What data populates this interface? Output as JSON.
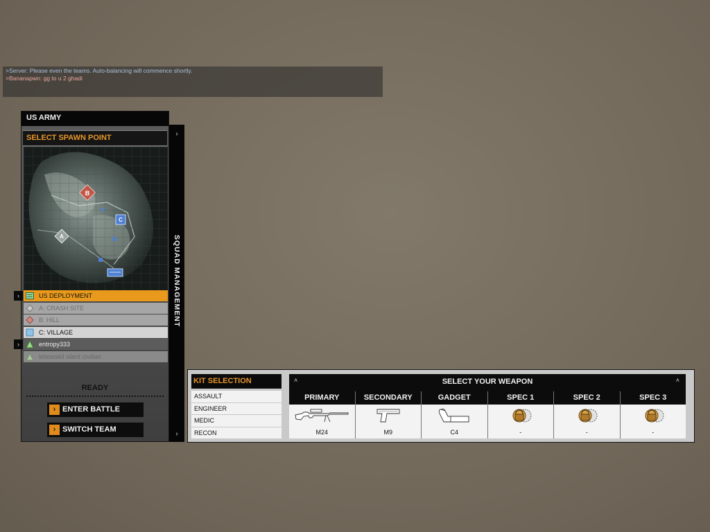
{
  "chat": {
    "lines": [
      ">Server: Please even the teams. Auto-balancing will commence shortly.",
      ">Bananapwn: gg to u 2 ghadi"
    ]
  },
  "team": {
    "name": "US ARMY"
  },
  "spawn": {
    "header": "SELECT SPAWN POINT",
    "map_markers": [
      "B",
      "A",
      "C"
    ],
    "points": [
      {
        "label": "US DEPLOYMENT",
        "state": "selected",
        "icon": "deployment-icon"
      },
      {
        "label": "A: CRASH SITE",
        "state": "disabled",
        "icon": "flag-a-icon"
      },
      {
        "label": "B: HILL",
        "state": "disabled",
        "icon": "flag-b-icon"
      },
      {
        "label": "C: VILLAGE",
        "state": "available",
        "icon": "flag-c-icon"
      },
      {
        "label": "entropy333",
        "state": "squad-selected",
        "icon": "soldier-icon"
      },
      {
        "label": "lebowskil silent civilian",
        "state": "squad-faded",
        "icon": "soldier-icon"
      }
    ],
    "ready_label": "READY",
    "enter_battle": "ENTER BATTLE",
    "switch_team": "SWITCH TEAM"
  },
  "squad": {
    "label": "SQUAD MANAGEMENT"
  },
  "kit": {
    "header": "KIT SELECTION",
    "items": [
      "ASSAULT",
      "ENGINEER",
      "MEDIC",
      "RECON"
    ]
  },
  "weapons": {
    "header": "SELECT YOUR WEAPON",
    "slots": [
      {
        "label": "PRIMARY",
        "weapon": "M24",
        "icon": "sniper-rifle-icon"
      },
      {
        "label": "SECONDARY",
        "weapon": "M9",
        "icon": "pistol-icon"
      },
      {
        "label": "GADGET",
        "weapon": "C4",
        "icon": "c4-explosive-icon"
      },
      {
        "label": "SPEC 1",
        "weapon": "-",
        "icon": "locked-spec-icon"
      },
      {
        "label": "SPEC 2",
        "weapon": "-",
        "icon": "locked-spec-icon"
      },
      {
        "label": "SPEC 3",
        "weapon": "-",
        "icon": "locked-spec-icon"
      }
    ]
  },
  "colors": {
    "accent_orange": "#e99a1c",
    "header_orange_text": "#e8962a",
    "panel_black": "#0b0b0b",
    "chat_server": "#a9c0dd",
    "chat_player": "#e9a89e"
  }
}
